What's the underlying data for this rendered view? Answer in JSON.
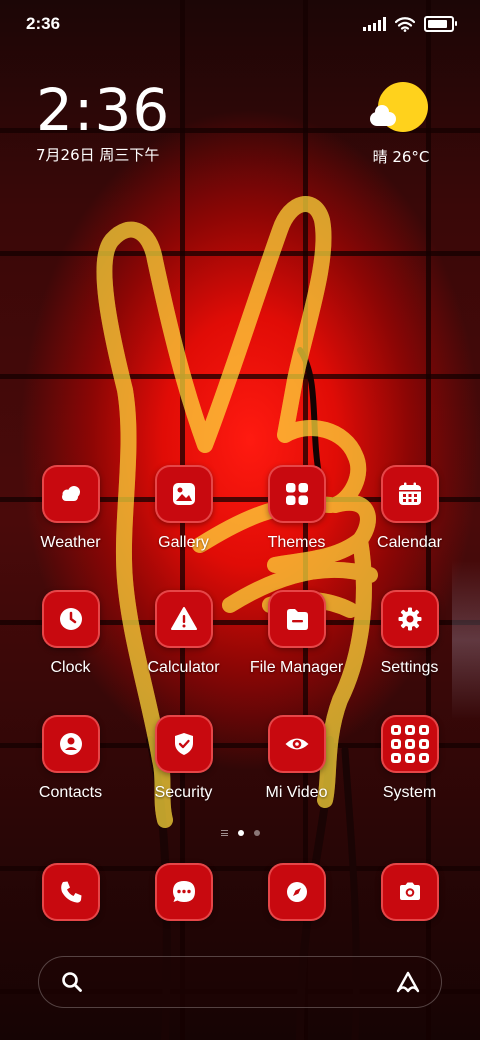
{
  "status_bar": {
    "time": "2:36",
    "battery_percent": 85
  },
  "clock_widget": {
    "time": "2:36",
    "date": "7月26日 周三下午"
  },
  "weather_widget": {
    "text": "晴 26°C",
    "icon": "partly-sunny-icon"
  },
  "apps": [
    {
      "label": "Weather",
      "icon": "weather-icon"
    },
    {
      "label": "Gallery",
      "icon": "gallery-icon"
    },
    {
      "label": "Themes",
      "icon": "themes-icon"
    },
    {
      "label": "Calendar",
      "icon": "calendar-icon"
    },
    {
      "label": "Clock",
      "icon": "clock-icon"
    },
    {
      "label": "Calculator",
      "icon": "calculator-icon"
    },
    {
      "label": "File Manager",
      "icon": "file-manager-icon"
    },
    {
      "label": "Settings",
      "icon": "settings-icon"
    },
    {
      "label": "Contacts",
      "icon": "contacts-icon"
    },
    {
      "label": "Security",
      "icon": "security-icon"
    },
    {
      "label": "Mi Video",
      "icon": "mi-video-icon"
    },
    {
      "label": "System",
      "icon": "system-folder-icon"
    }
  ],
  "page_indicator": {
    "pages": 2,
    "current": 1
  },
  "dock": [
    {
      "icon": "phone-icon"
    },
    {
      "icon": "messages-icon"
    },
    {
      "icon": "browser-icon"
    },
    {
      "icon": "camera-icon"
    }
  ],
  "search_bar": {
    "icon": "search-icon",
    "assistant_icon": "assistant-icon"
  },
  "colors": {
    "icon_bg": "#c8090f",
    "sun": "#ffd21c",
    "neon": "#f2c400"
  }
}
